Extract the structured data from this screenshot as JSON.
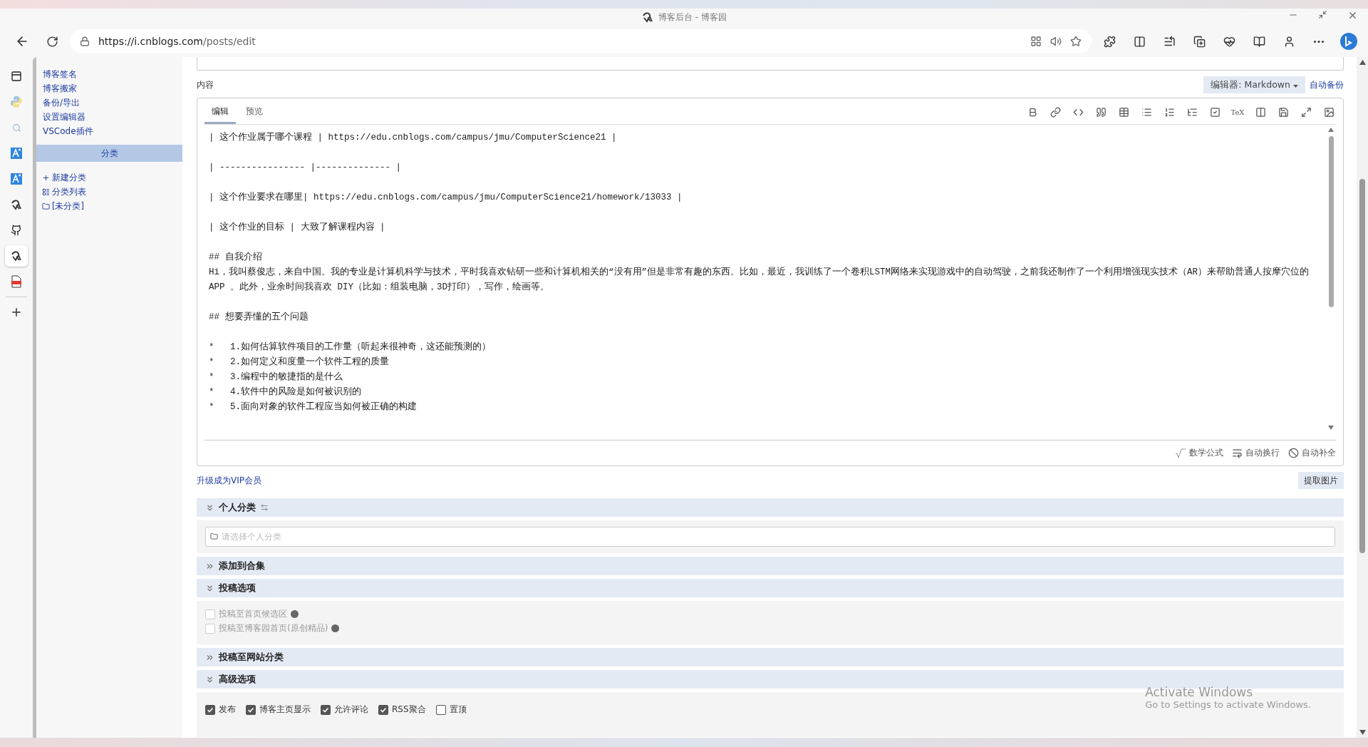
{
  "browser": {
    "title": "博客后台 - 博客园",
    "url_host": "https://i.cnblogs.com",
    "url_path": "/posts/edit"
  },
  "rail": [
    {
      "kind": "tabs",
      "selected": false
    },
    {
      "kind": "python",
      "selected": false
    },
    {
      "kind": "search",
      "selected": false
    },
    {
      "kind": "translate",
      "selected": false
    },
    {
      "kind": "translate",
      "selected": false
    },
    {
      "kind": "cnblogs",
      "selected": false
    },
    {
      "kind": "github",
      "selected": false
    },
    {
      "kind": "cnblogs",
      "selected": true
    },
    {
      "kind": "pdf",
      "selected": false
    }
  ],
  "nav": {
    "links": [
      "博客签名",
      "博客搬家",
      "备份/导出",
      "设置编辑器",
      "VSCode插件"
    ],
    "category_header": "分类",
    "category_items": [
      {
        "kind": "add",
        "label": "新建分类"
      },
      {
        "kind": "list",
        "label": "分类列表"
      },
      {
        "kind": "folder",
        "label": "[未分类]"
      }
    ]
  },
  "content_label": "内容",
  "editor": {
    "mode_button": "编辑器: Markdown",
    "backup_link": "自动备份",
    "tabs": [
      {
        "label": "编辑",
        "selected": true
      },
      {
        "label": "预览",
        "selected": false
      }
    ],
    "toolbar": [
      {
        "kind": "bold"
      },
      {
        "kind": "link"
      },
      {
        "kind": "code"
      },
      {
        "kind": "quote"
      },
      {
        "kind": "table"
      },
      {
        "kind": "ul"
      },
      {
        "kind": "ol"
      },
      {
        "kind": "indent"
      },
      {
        "kind": "task"
      },
      {
        "kind": "tex",
        "label": "TeX"
      },
      {
        "kind": "split"
      },
      {
        "kind": "save"
      },
      {
        "kind": "fullscreen"
      },
      {
        "kind": "image"
      }
    ],
    "blocks": [
      [
        "| 这个作业属于哪个课程 | https://edu.cnblogs.com/campus/jmu/ComputerScience21 |"
      ],
      [
        "| ---------------- |-------------- |"
      ],
      [
        "| 这个作业要求在哪里| https://edu.cnblogs.com/campus/jmu/ComputerScience21/homework/13033 |"
      ],
      [
        "| 这个作业的目标 | 大致了解课程内容 |"
      ],
      [
        "## 自我介绍",
        "Hi，我叫蔡俊志，来自中国。我的专业是计算机科学与技术，平时我喜欢钻研一些和计算机相关的“没有用”但是非常有趣的东西。比如，最近，我训练了一个卷积LSTM网络来实现游戏中的自动驾驶，之前我还制作了一个利用增强现实技术（AR）来帮助普通人按摩穴位的 APP 。此外，业余时间我喜欢 DIY（比如：组装电脑，3D打印），写作，绘画等。"
      ],
      [
        "## 想要弄懂的五个问题"
      ],
      [
        "*   1.如何估算软件项目的工作量（听起来很神奇，这还能预测的）",
        "*   2.如何定义和度量一个软件工程的质量",
        "*   3.编程中的敏捷指的是什么",
        "*   4.软件中的风险是如何被识别的",
        "*   5.面向对象的软件工程应当如何被正确的构建"
      ]
    ],
    "footer_items": [
      {
        "kind": "math",
        "label": "数学公式"
      },
      {
        "kind": "wrap",
        "label": "自动换行"
      },
      {
        "kind": "complete",
        "label": "自动补全"
      }
    ]
  },
  "vip_link": "升级成为VIP会员",
  "extract_button": "提取图片",
  "sections": [
    {
      "kind": "category",
      "title": "个人分类",
      "expanded": true,
      "placeholder": "请选择个人分类"
    },
    {
      "kind": "plain",
      "title": "添加到合集",
      "expanded": false
    },
    {
      "kind": "checklist",
      "title": "投稿选项",
      "expanded": true,
      "options": [
        {
          "label": "投稿至首页候选区",
          "checked": false,
          "disabled": true,
          "help": true
        },
        {
          "label": "投稿至博客园首页(原创精品)",
          "checked": false,
          "disabled": true,
          "help": true
        }
      ]
    },
    {
      "kind": "plain",
      "title": "投稿至网站分类",
      "expanded": false
    },
    {
      "kind": "checkrow",
      "title": "高级选项",
      "expanded": true,
      "options": [
        {
          "label": "发布",
          "checked": true,
          "disabled": false,
          "help": false
        },
        {
          "label": "博客主页显示",
          "checked": true,
          "disabled": false,
          "help": false
        },
        {
          "label": "允许评论",
          "checked": true,
          "disabled": false,
          "help": false
        },
        {
          "label": "RSS聚合",
          "checked": true,
          "disabled": false,
          "help": false
        },
        {
          "label": "置顶",
          "checked": false,
          "disabled": false,
          "help": false
        }
      ]
    }
  ],
  "activation": {
    "title": "Activate Windows",
    "subtitle": "Go to Settings to activate Windows."
  }
}
